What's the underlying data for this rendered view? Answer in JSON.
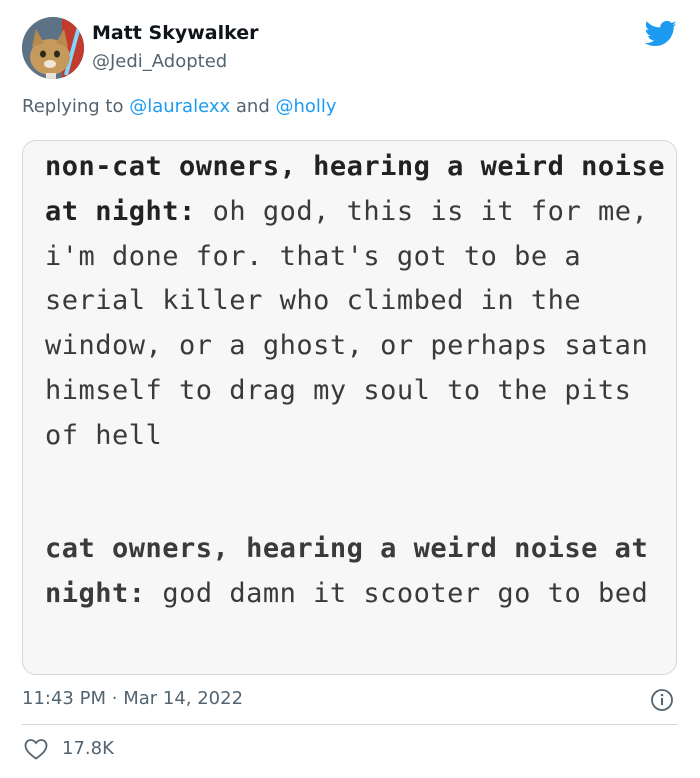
{
  "user": {
    "name": "Matt Skywalker",
    "handle": "@Jedi_Adopted"
  },
  "reply": {
    "prefix": "Replying to",
    "mention1": "@lauralexx",
    "joiner": "and",
    "mention2": "@holly"
  },
  "post_image": {
    "para1_bold": "non-cat owners, hearing a weird noise at night:",
    "para1_text": "oh god, this is it for me, i'm done for. that's got to be a serial killer who climbed in the window, or a ghost, or perhaps satan himself to drag my soul to the pits of hell",
    "para2_bold": "cat owners, hearing a weird noise at night:",
    "para2_text": "god damn it scooter go to bed"
  },
  "meta": {
    "time": "11:43 PM",
    "separator": "·",
    "date": "Mar 14, 2022"
  },
  "engagement": {
    "likes": "17.8K"
  },
  "colors": {
    "brand": "#1d9bf0",
    "secondary_text": "#536471",
    "border": "#cfd9de"
  }
}
